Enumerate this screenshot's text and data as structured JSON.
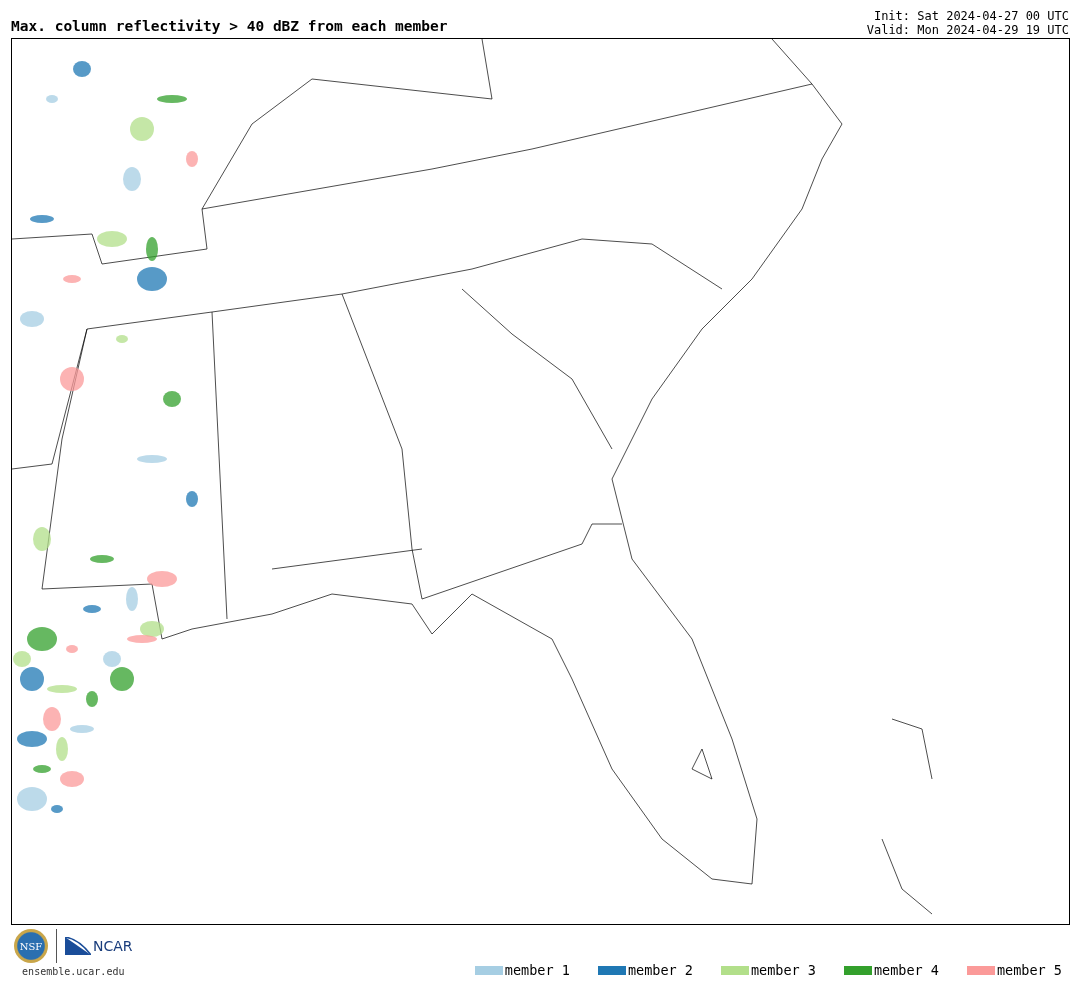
{
  "title": "Max. column reflectivity > 40 dBZ from each member",
  "init": "Init: Sat 2024-04-27 00 UTC",
  "valid": "Valid: Mon 2024-04-29 19 UTC",
  "logos": {
    "nsf": "NSF",
    "ncar": "NCAR",
    "url": "ensemble.ucar.edu"
  },
  "legend": [
    {
      "label": "member 1",
      "color": "#a6cee3"
    },
    {
      "label": "member 2",
      "color": "#1f78b4"
    },
    {
      "label": "member 3",
      "color": "#b2df8a"
    },
    {
      "label": "member 4",
      "color": "#33a02c"
    },
    {
      "label": "member 5",
      "color": "#fb9a99"
    }
  ]
}
